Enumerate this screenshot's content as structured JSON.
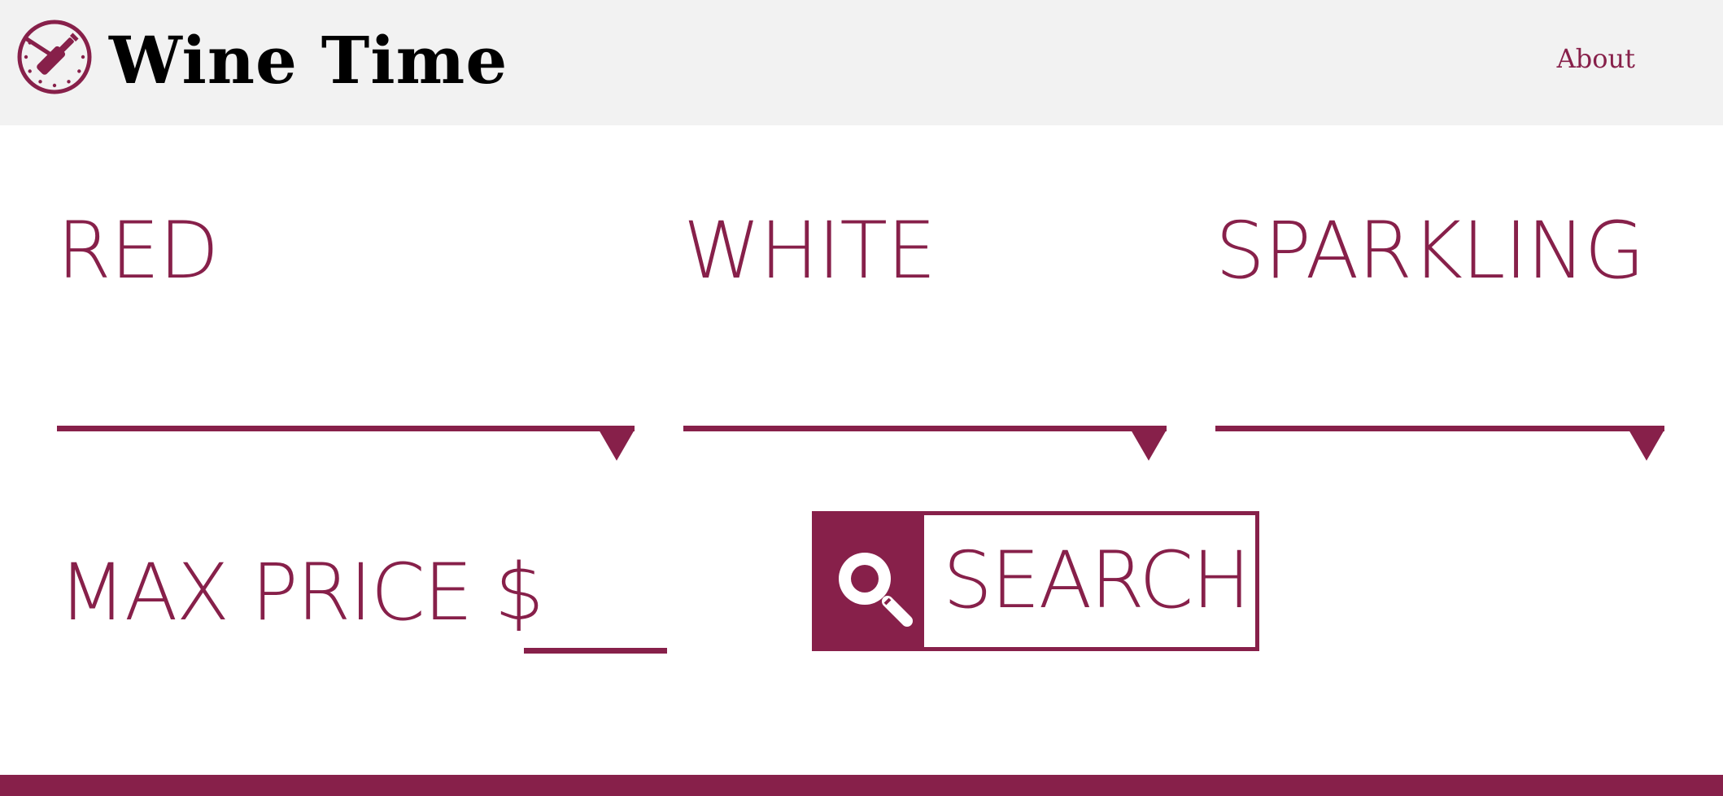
{
  "header": {
    "brand": "Wine Time",
    "about_link": "About",
    "logo_icon": "clock-wine-bottle-icon"
  },
  "selects": [
    {
      "label": "RED",
      "icon": "triangle-down-icon"
    },
    {
      "label": "WHITE",
      "icon": "triangle-down-icon"
    },
    {
      "label": "SPARKLING",
      "icon": "triangle-down-icon"
    }
  ],
  "price": {
    "label": "MAX PRICE $",
    "value": ""
  },
  "search": {
    "label": "SEARCH",
    "icon": "search-icon"
  },
  "colors": {
    "accent": "#87204a",
    "header_bg": "#f2f2f2",
    "brand_text": "#000000"
  }
}
